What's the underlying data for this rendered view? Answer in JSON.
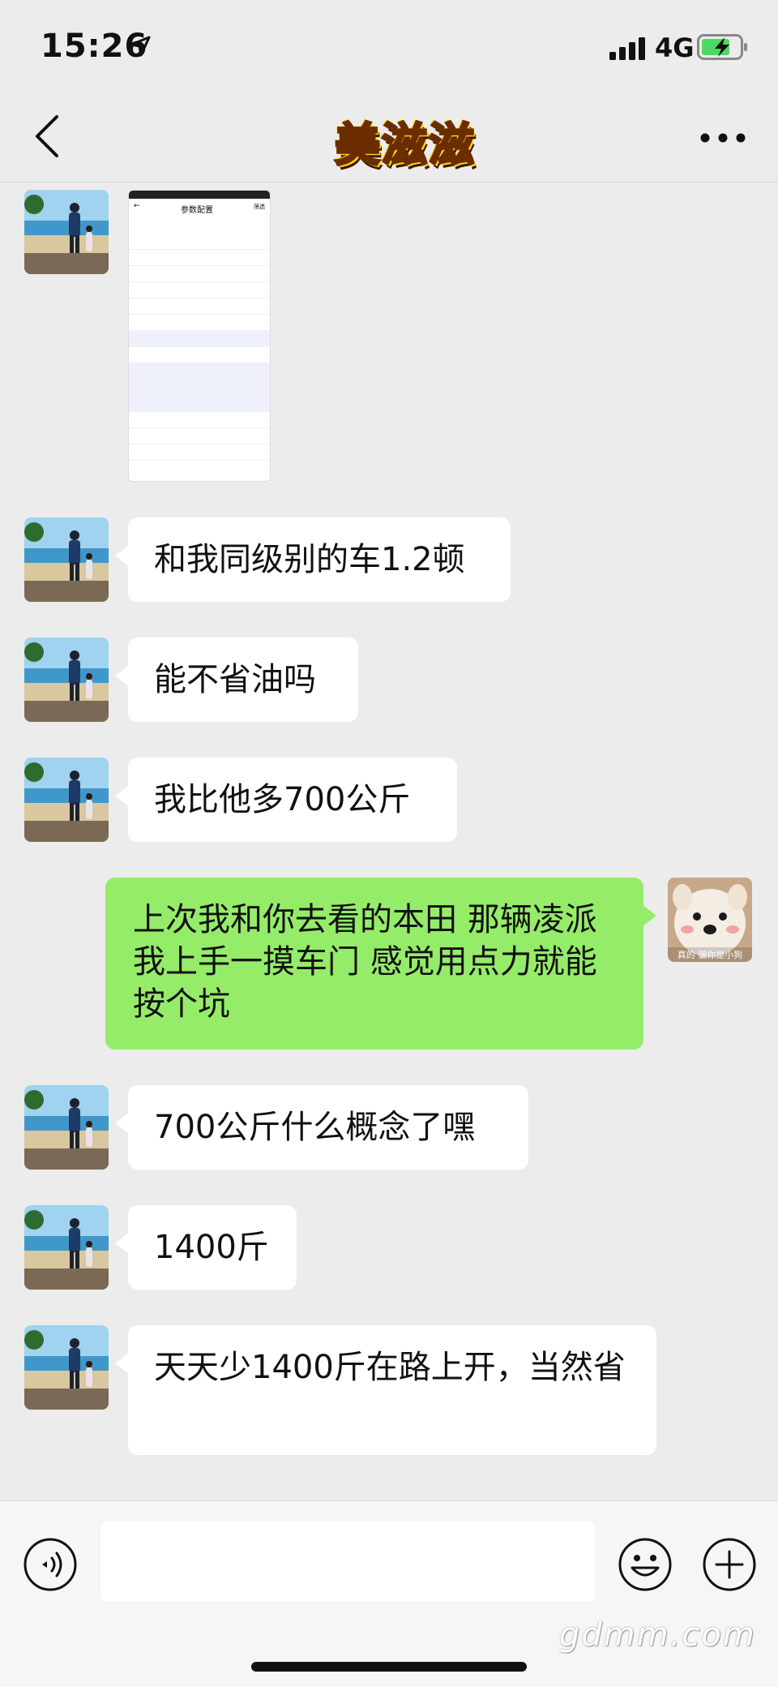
{
  "status_bar": {
    "time": "15:26",
    "network": "4G"
  },
  "header": {
    "title": "美滋滋"
  },
  "messages": [
    {
      "text": "和我同级别的车1.2顿"
    },
    {
      "text": "能不省油吗"
    },
    {
      "text": "我比他多700公斤"
    },
    {
      "text": "上次我和你去看的本田 那辆凌派 我上手一摸车门 感觉用点力就能按个坑"
    },
    {
      "text": "700公斤什么概念了嘿"
    },
    {
      "text": "1400斤"
    },
    {
      "text": "天天少1400斤在路上开，当然省"
    }
  ],
  "shared_image": {
    "title": "参数配置",
    "action": "筛选"
  },
  "avatar_me": {
    "caption": "真的 骗你是小狗"
  },
  "watermark": "gdmm.com",
  "colors": {
    "outgoing_bubble": "#95ec69",
    "incoming_bubble": "#ffffff",
    "background": "#ececec",
    "battery": "#4cd964"
  }
}
